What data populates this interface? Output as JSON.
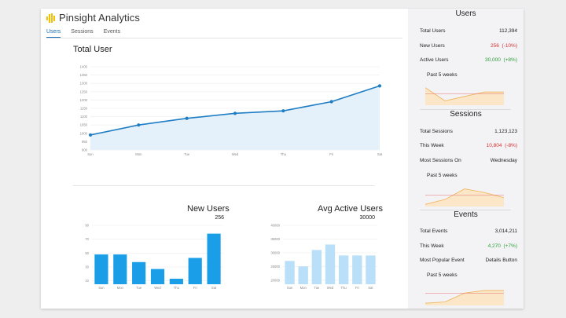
{
  "app": {
    "name": "Pinsight Analytics",
    "logo_color": "#f2c200"
  },
  "tabs": [
    {
      "label": "Users",
      "active": true
    },
    {
      "label": "Sessions",
      "active": false
    },
    {
      "label": "Events",
      "active": false
    }
  ],
  "total_user": {
    "title": "Total User"
  },
  "new_users": {
    "title": "New Users",
    "value": "256"
  },
  "avg_active_users": {
    "title": "Avg Active Users",
    "value": "30000"
  },
  "sidebar": {
    "users": {
      "heading": "Users",
      "rows": [
        {
          "label": "Total Users",
          "value": "112,394",
          "change": ""
        },
        {
          "label": "New Users",
          "value": "256",
          "change": "(-10%)",
          "tone": "red"
        },
        {
          "label": "Active Users",
          "value": "30,000",
          "change": "(+8%)",
          "tone": "green"
        }
      ],
      "spark_label": "Past 5 weeks"
    },
    "sessions": {
      "heading": "Sessions",
      "rows": [
        {
          "label": "Total Sessions",
          "value": "1,123,123",
          "change": ""
        },
        {
          "label": "This Week",
          "value": "10,804",
          "change": "(-8%)",
          "tone": "red"
        },
        {
          "label": "Most Sessions On",
          "value": "Wednesday",
          "change": ""
        }
      ],
      "spark_label": "Past 5 weeks"
    },
    "events": {
      "heading": "Events",
      "rows": [
        {
          "label": "Total Events",
          "value": "3,014,211",
          "change": ""
        },
        {
          "label": "This Week",
          "value": "4,270",
          "change": "(+7%)",
          "tone": "green"
        },
        {
          "label": "Most Popular Event",
          "value": "Details Button",
          "change": ""
        }
      ],
      "spark_label": "Past 5 weeks"
    }
  },
  "colors": {
    "accent": "#1a6fb5",
    "line": "#1f7dc4",
    "area_fill": "#e4f1fb",
    "bar": "#1a9ee8",
    "bar_light": "#b9e0f8",
    "spark_fill": "#fbe6c8",
    "spark_line": "#f0b35a",
    "spark_ref": "#e57373",
    "red": "#d32f2f",
    "green": "#2e9d3a"
  },
  "chart_data": [
    {
      "type": "area",
      "title": "Total User",
      "categories": [
        "Sun",
        "Mon",
        "Tue",
        "Wed",
        "Thu",
        "Fri",
        "Sat"
      ],
      "values": [
        990,
        1050,
        1090,
        1120,
        1135,
        1190,
        1285
      ],
      "y_ticks": [
        900,
        950,
        1000,
        1050,
        1100,
        1150,
        1200,
        1250,
        1300,
        1350,
        1400
      ],
      "ylim": [
        900,
        1400
      ],
      "grid": true
    },
    {
      "type": "bar",
      "title": "New Users",
      "categories": [
        "Sun",
        "Mon",
        "Tue",
        "Wed",
        "Thu",
        "Fri",
        "Sat"
      ],
      "values": [
        48,
        48,
        37,
        27,
        13,
        43,
        78
      ],
      "y_ticks": [
        10,
        30,
        50,
        70,
        90
      ],
      "ylim": [
        5,
        90
      ],
      "grid": true
    },
    {
      "type": "bar",
      "title": "Avg Active Users",
      "categories": [
        "Sun",
        "Mon",
        "Tue",
        "Wed",
        "Thu",
        "Fri",
        "Sat"
      ],
      "values": [
        27000,
        25000,
        31000,
        33000,
        29000,
        29000,
        29000
      ],
      "y_ticks": [
        20000,
        25000,
        30000,
        35000,
        40000
      ],
      "ylim": [
        18500,
        40000
      ],
      "grid": true
    },
    {
      "type": "area",
      "title": "Users past 5 weeks",
      "values": [
        4,
        1,
        2,
        3,
        3
      ],
      "reference": 2.6,
      "ylim": [
        0,
        5
      ]
    },
    {
      "type": "area",
      "title": "Sessions past 5 weeks",
      "values": [
        0.5,
        1.6,
        4,
        3.2,
        2
      ],
      "reference": 2.6,
      "ylim": [
        0,
        5
      ]
    },
    {
      "type": "area",
      "title": "Events past 5 weeks",
      "values": [
        0.5,
        0.8,
        2.8,
        3.4,
        3.4
      ],
      "reference": 2.8,
      "ylim": [
        0,
        5
      ]
    }
  ]
}
